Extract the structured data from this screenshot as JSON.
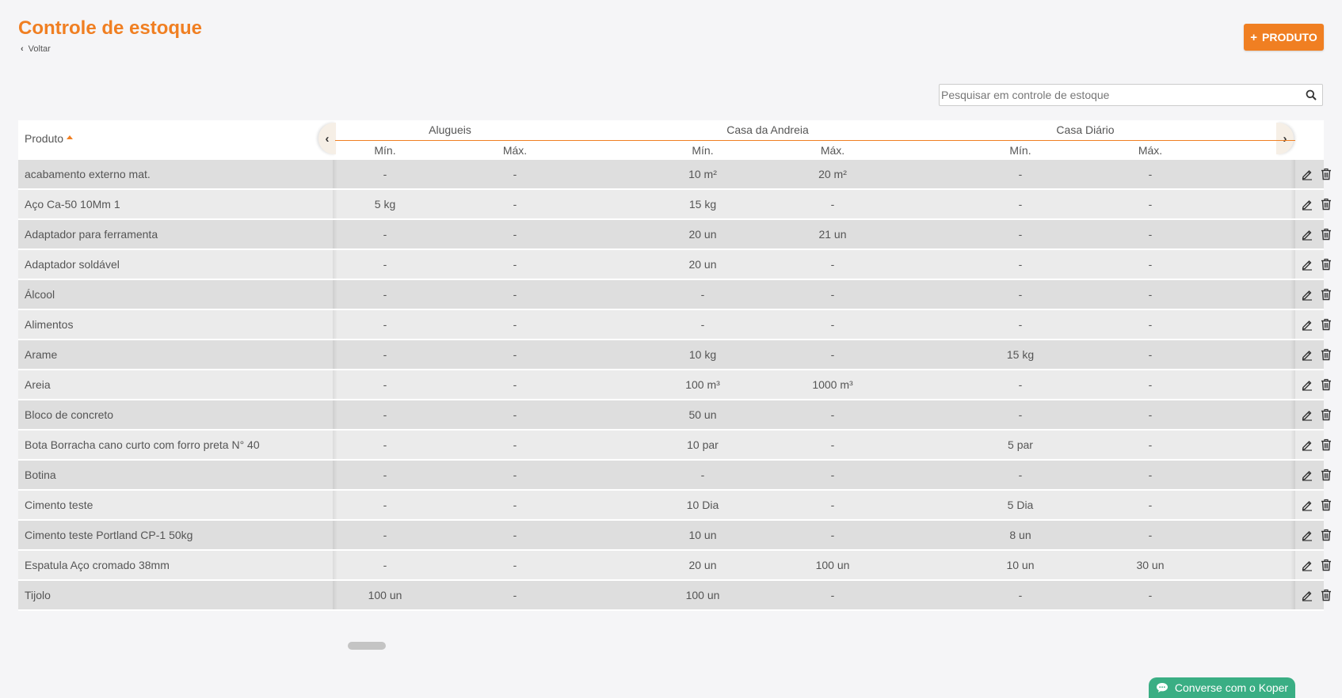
{
  "header": {
    "title": "Controle de estoque",
    "back_label": "Voltar",
    "add_button_label": "PRODUTO"
  },
  "search": {
    "placeholder": "Pesquisar em controle de estoque",
    "value": ""
  },
  "table": {
    "product_header": "Produto",
    "groups": [
      {
        "name": "Alugueis",
        "min": "Mín.",
        "max": "Máx."
      },
      {
        "name": "Casa da Andreia",
        "min": "Mín.",
        "max": "Máx."
      },
      {
        "name": "Casa Diário",
        "min": "Mín.",
        "max": "Máx."
      }
    ],
    "rows": [
      {
        "name": "acabamento externo mat.",
        "vals": [
          "-",
          "-",
          "10 m²",
          "20 m²",
          "-",
          "-"
        ]
      },
      {
        "name": "Aço Ca-50 10Mm 1",
        "vals": [
          "5 kg",
          "-",
          "15 kg",
          "-",
          "-",
          "-"
        ]
      },
      {
        "name": "Adaptador para ferramenta",
        "vals": [
          "-",
          "-",
          "20 un",
          "21 un",
          "-",
          "-"
        ]
      },
      {
        "name": "Adaptador soldável",
        "vals": [
          "-",
          "-",
          "20 un",
          "-",
          "-",
          "-"
        ]
      },
      {
        "name": "Álcool",
        "vals": [
          "-",
          "-",
          "-",
          "-",
          "-",
          "-"
        ]
      },
      {
        "name": "Alimentos",
        "vals": [
          "-",
          "-",
          "-",
          "-",
          "-",
          "-"
        ]
      },
      {
        "name": "Arame",
        "vals": [
          "-",
          "-",
          "10 kg",
          "-",
          "15 kg",
          "-"
        ]
      },
      {
        "name": "Areia",
        "vals": [
          "-",
          "-",
          "100 m³",
          "1000 m³",
          "-",
          "-"
        ]
      },
      {
        "name": "Bloco de concreto",
        "vals": [
          "-",
          "-",
          "50 un",
          "-",
          "-",
          "-"
        ]
      },
      {
        "name": "Bota Borracha cano curto com forro preta N° 40",
        "vals": [
          "-",
          "-",
          "10 par",
          "-",
          "5 par",
          "-"
        ]
      },
      {
        "name": "Botina",
        "vals": [
          "-",
          "-",
          "-",
          "-",
          "-",
          "-"
        ]
      },
      {
        "name": "Cimento teste",
        "vals": [
          "-",
          "-",
          "10 Dia",
          "-",
          "5 Dia",
          "-"
        ]
      },
      {
        "name": "Cimento teste Portland CP-1 50kg",
        "vals": [
          "-",
          "-",
          "10 un",
          "-",
          "8 un",
          "-"
        ]
      },
      {
        "name": "Espatula Aço cromado 38mm",
        "vals": [
          "-",
          "-",
          "20 un",
          "100 un",
          "10 un",
          "30 un"
        ]
      },
      {
        "name": "Tijolo",
        "vals": [
          "100 un",
          "-",
          "100 un",
          "-",
          "-",
          "-"
        ]
      }
    ]
  },
  "chat": {
    "label": "Converse com o Koper"
  },
  "colors": {
    "accent": "#f07f22",
    "chat": "#3aae84"
  }
}
